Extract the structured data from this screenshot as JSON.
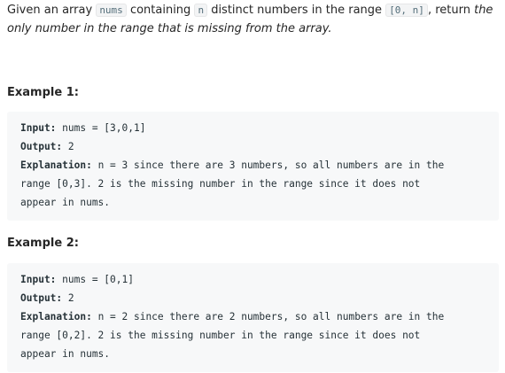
{
  "description": {
    "part1": "Given an array ",
    "code1": "nums",
    "part2": " containing ",
    "code2": "n",
    "part3": " distinct numbers in the range ",
    "code3": "[0, n]",
    "part4": ", return ",
    "italic": "the only number in the range that is missing from the array."
  },
  "examples": [
    {
      "title": "Example 1:",
      "input_label": "Input:",
      "input_value": " nums = [3,0,1]",
      "output_label": "Output:",
      "output_value": " 2",
      "explanation_label": "Explanation:",
      "explanation_line1": " n = 3 since there are 3 numbers, so all numbers are in the",
      "explanation_line2": "range [0,3]. 2 is the missing number in the range since it does not",
      "explanation_line3": "appear in nums."
    },
    {
      "title": "Example 2:",
      "input_label": "Input:",
      "input_value": " nums = [0,1]",
      "output_label": "Output:",
      "output_value": " 2",
      "explanation_label": "Explanation:",
      "explanation_line1": " n = 2 since there are 2 numbers, so all numbers are in the",
      "explanation_line2": "range [0,2]. 2 is the missing number in the range since it does not",
      "explanation_line3": "appear in nums."
    }
  ]
}
